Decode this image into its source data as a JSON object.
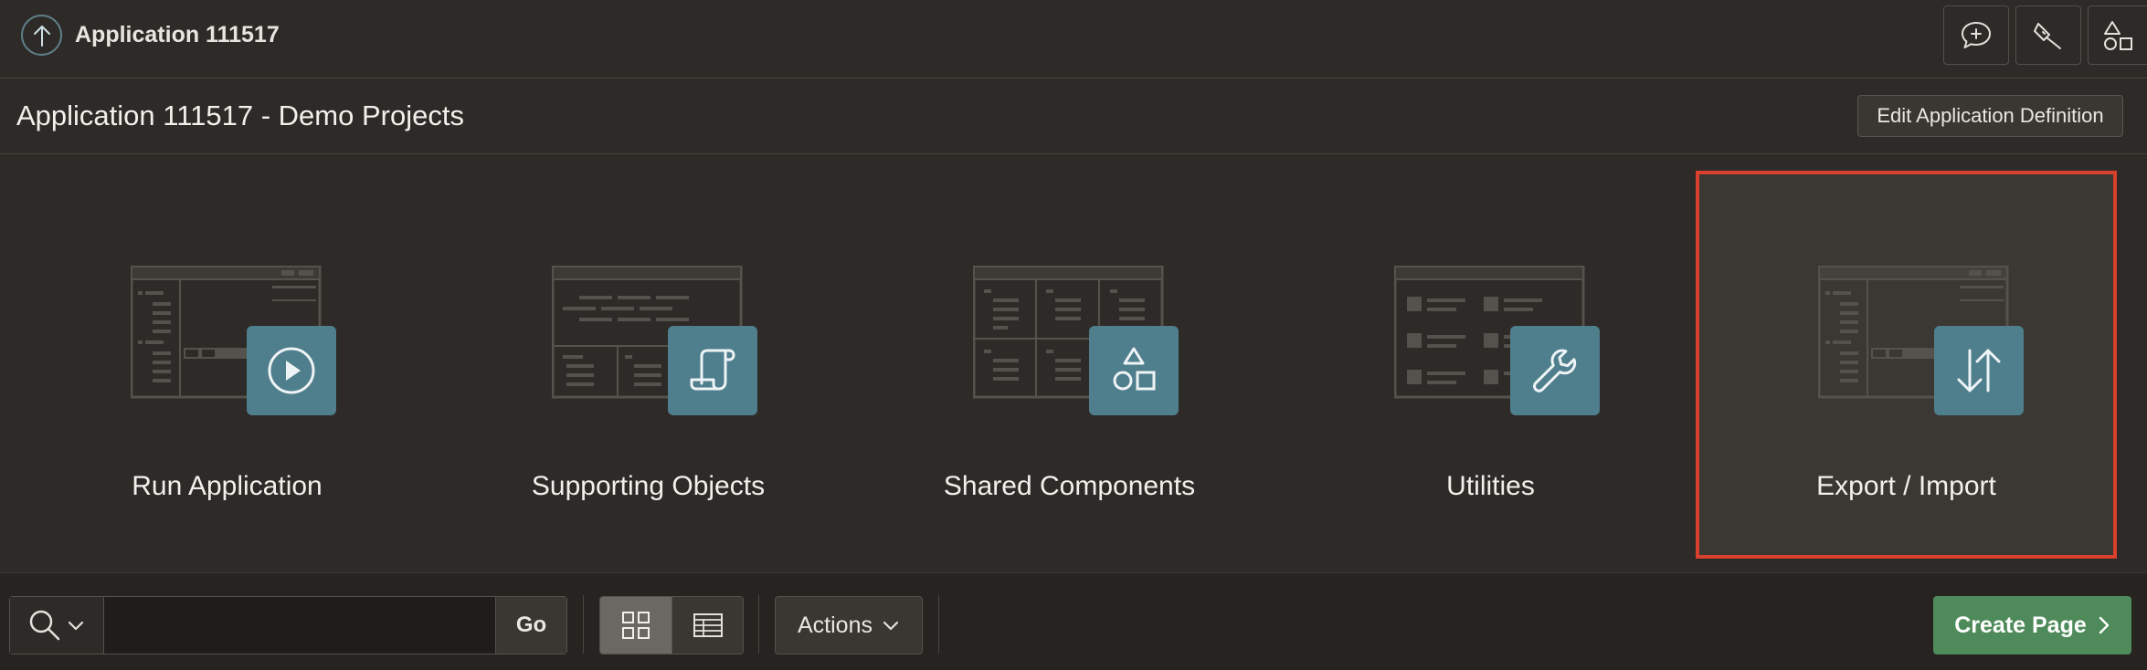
{
  "topbar": {
    "app_crumb": "Application 111517",
    "icons": [
      "feedback-icon",
      "developer-toolbar-icon",
      "shared-components-icon"
    ]
  },
  "titleband": {
    "page_title": "Application 111517 - Demo Projects",
    "edit_button": "Edit Application Definition"
  },
  "tiles": [
    {
      "label": "Run Application",
      "icon": "play-icon",
      "selected": false
    },
    {
      "label": "Supporting Objects",
      "icon": "scroll-icon",
      "selected": false
    },
    {
      "label": "Shared Components",
      "icon": "shapes-icon",
      "selected": false
    },
    {
      "label": "Utilities",
      "icon": "wrench-icon",
      "selected": false
    },
    {
      "label": "Export / Import",
      "icon": "arrows-up-down-icon",
      "selected": true
    }
  ],
  "toolbar": {
    "search_value": "",
    "go_label": "Go",
    "view_mode": "icons",
    "actions_label": "Actions",
    "create_label": "Create Page"
  },
  "colors": {
    "background": "#2d2a27",
    "badge": "#4f7e8c",
    "selection": "#d9402e",
    "create_button": "#4e8a5a"
  }
}
